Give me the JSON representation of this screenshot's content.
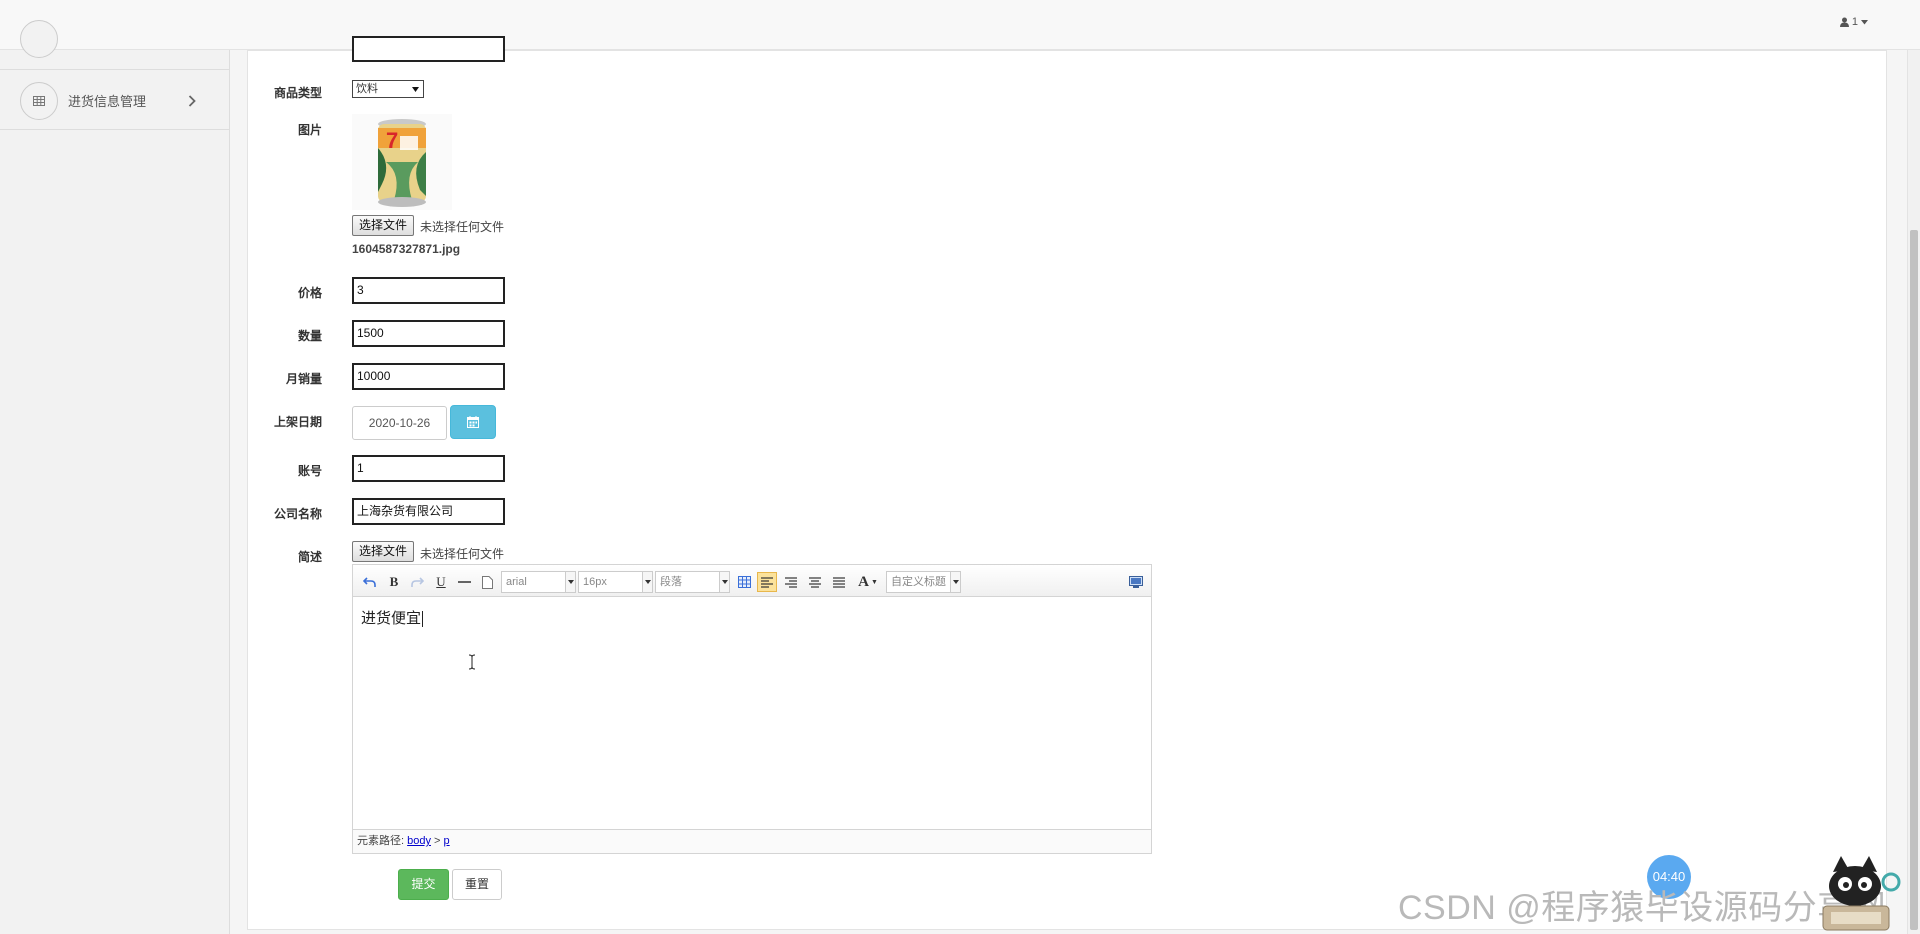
{
  "header": {
    "user_label": "1"
  },
  "sidebar": {
    "items": [
      {
        "label": "进货信息管理"
      }
    ]
  },
  "form": {
    "product_type_label": "商品类型",
    "product_type_value": "饮料",
    "image_label": "图片",
    "choose_file_label": "选择文件",
    "no_file_text": "未选择任何文件",
    "image_filename": "1604587327871.jpg",
    "price_label": "价格",
    "price_value": "3",
    "quantity_label": "数量",
    "quantity_value": "1500",
    "monthly_sales_label": "月销量",
    "monthly_sales_value": "10000",
    "listing_date_label": "上架日期",
    "listing_date_value": "2020-10-26",
    "account_label": "账号",
    "account_value": "1",
    "company_label": "公司名称",
    "company_value": "上海杂货有限公司",
    "description_label": "简述",
    "description_choose_file_label": "选择文件",
    "description_no_file_text": "未选择任何文件",
    "submit_label": "提交",
    "reset_label": "重置"
  },
  "editor": {
    "font_family": "arial",
    "font_size": "16px",
    "paragraph": "段落",
    "custom_title": "自定义标题",
    "content": "进货便宜",
    "path_prefix": "元素路径:",
    "path_body": "body",
    "path_sep": ">",
    "path_p": "p"
  },
  "overlay": {
    "timer": "04:40",
    "watermark": "CSDN @程序猿毕设源码分享网"
  }
}
